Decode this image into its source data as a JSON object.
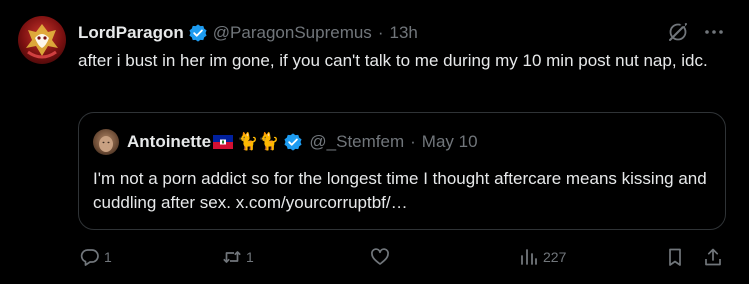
{
  "tweet": {
    "display_name": "LordParagon",
    "handle": "@ParagonSupremus",
    "separator": "·",
    "time": "13h",
    "text": "after i bust in her im gone, if you can't talk to me during my 10 min post nut nap, idc."
  },
  "quote": {
    "display_name": "Antoinette",
    "emoji": "🐈🐈",
    "handle": "@_Stemfem",
    "separator": "·",
    "date": "May 10",
    "text": "I'm not a porn addict so for the longest time I thought aftercare means kissing and cuddling after sex. x.com/yourcorruptbf/…"
  },
  "actions": {
    "reply_count": "1",
    "retweet_count": "1",
    "like_count": "",
    "views_count": "227"
  },
  "colors": {
    "background": "#000000",
    "text_primary": "#e7e9ea",
    "text_secondary": "#71767b",
    "verified": "#1d9bf0",
    "border": "#2f3336"
  },
  "icons": [
    "verified-badge-icon",
    "grok-icon",
    "more-icon",
    "reply-icon",
    "retweet-icon",
    "like-icon",
    "views-icon",
    "bookmark-icon",
    "share-icon",
    "haiti-flag-icon"
  ]
}
